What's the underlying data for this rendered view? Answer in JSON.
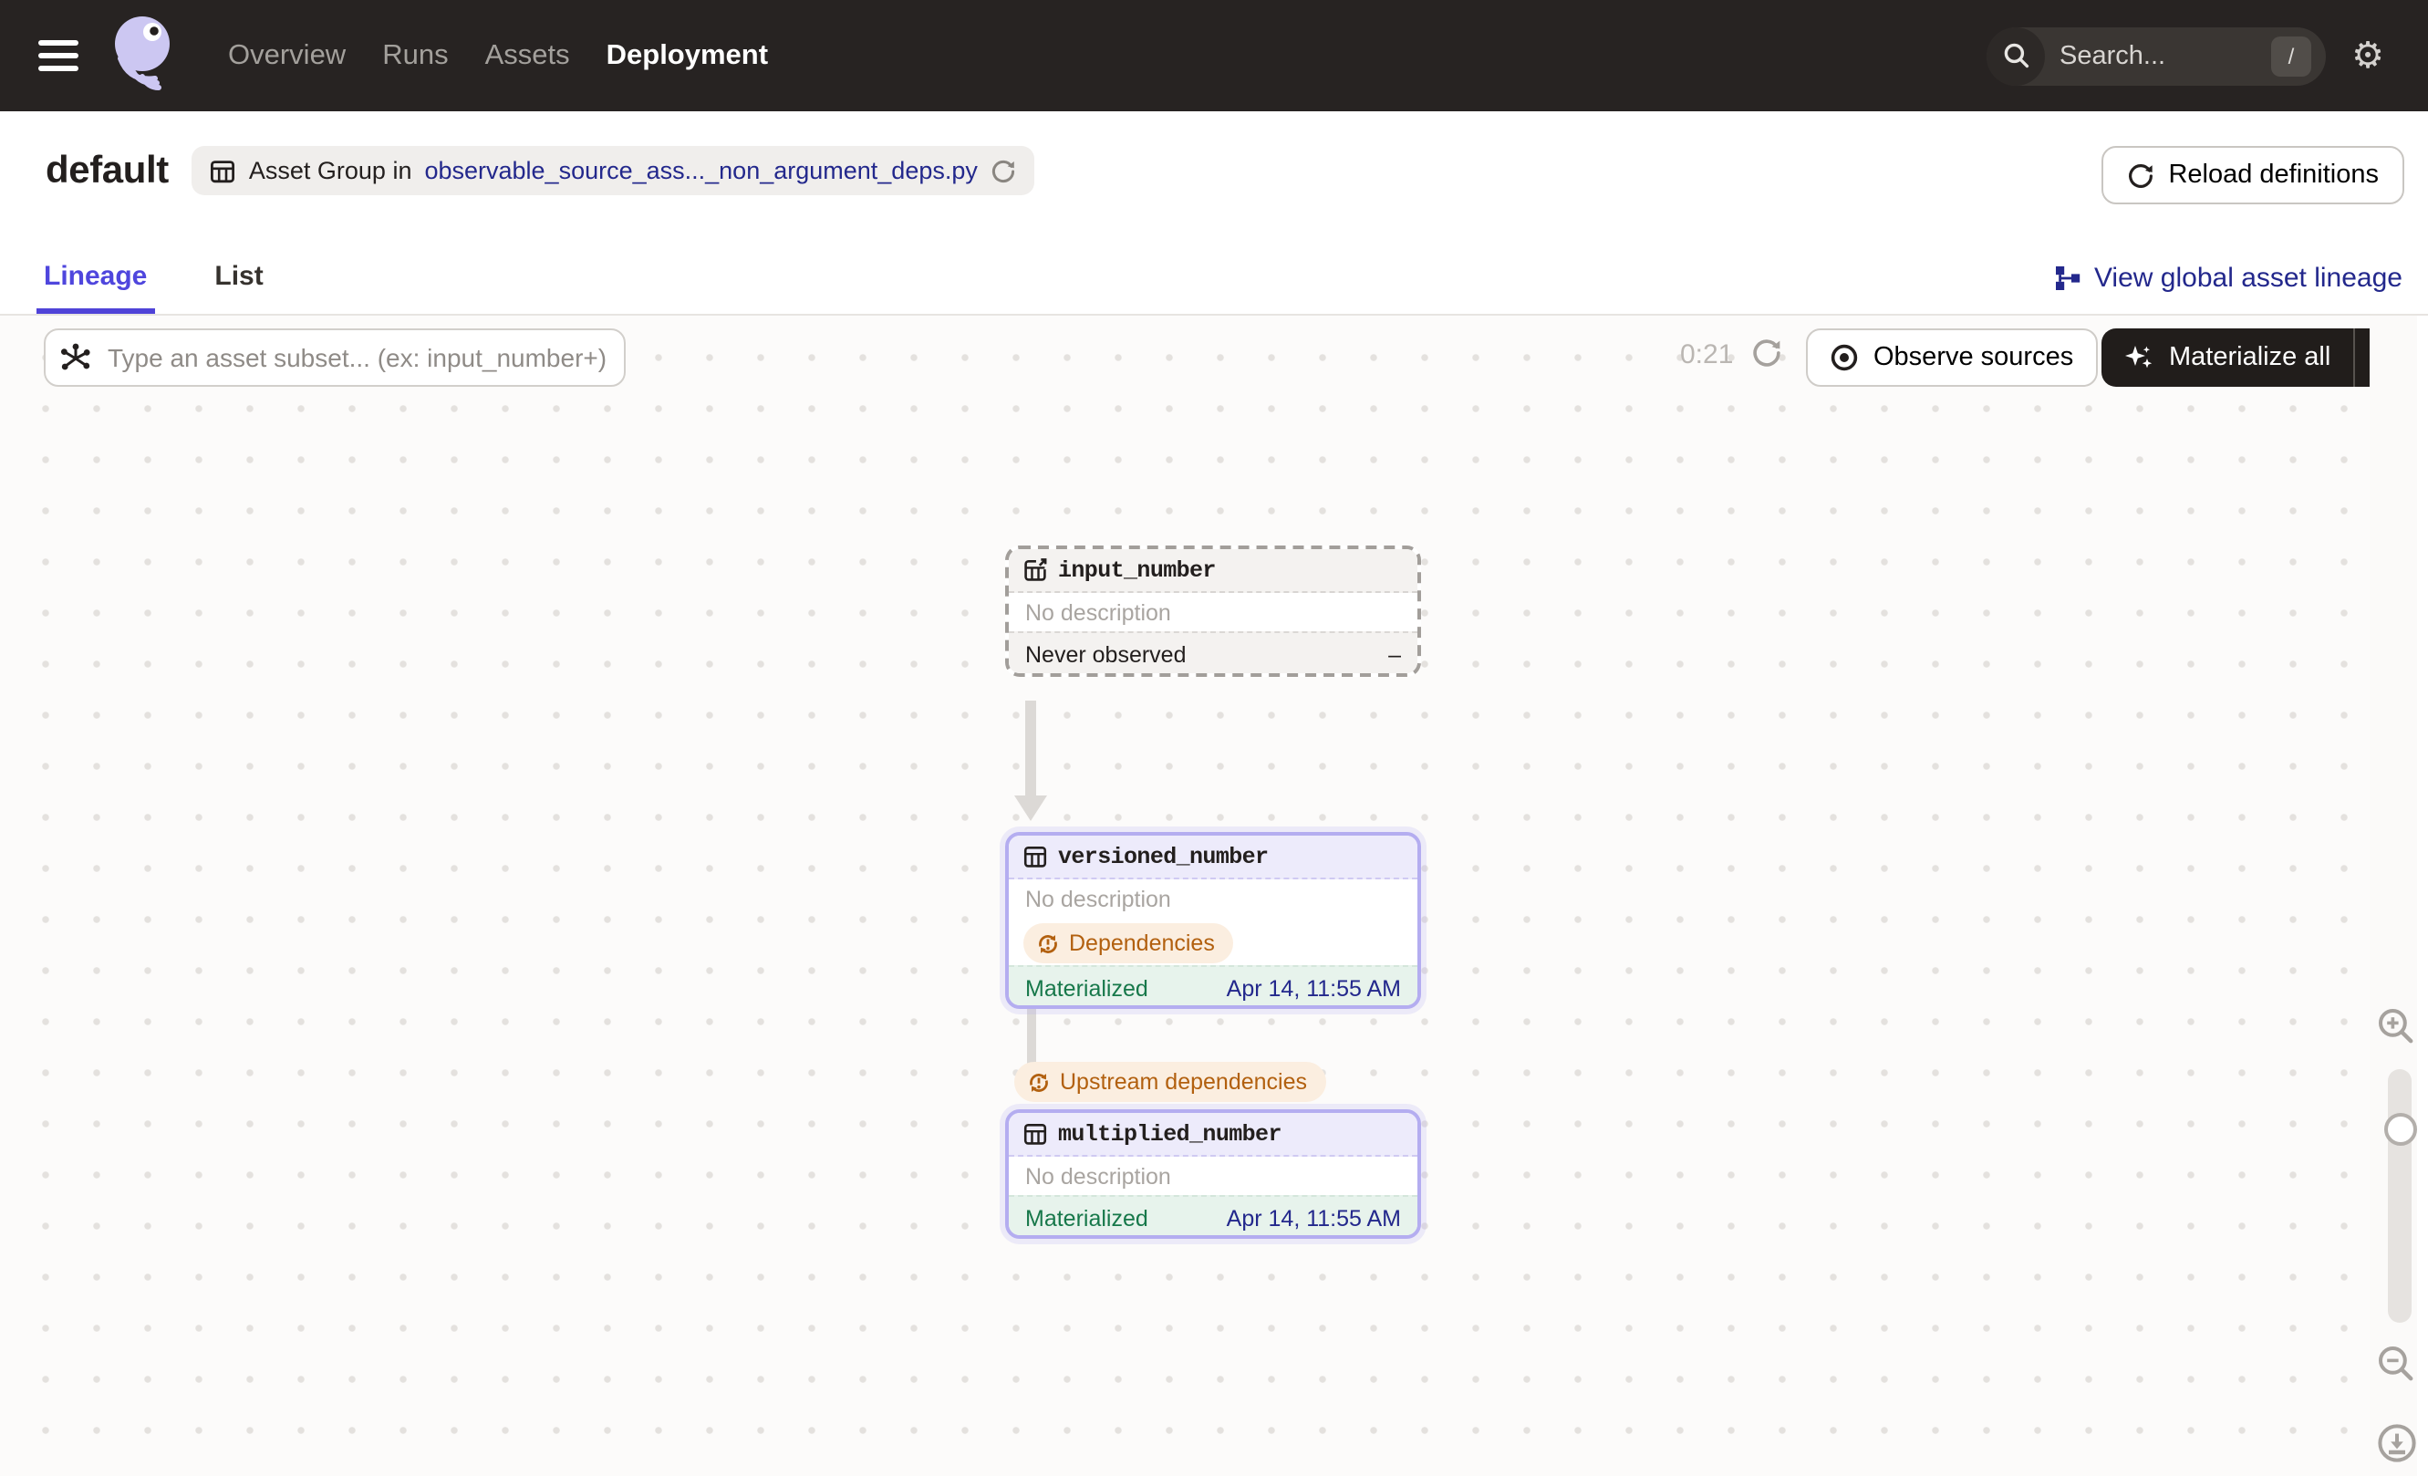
{
  "nav": {
    "items": [
      {
        "label": "Overview",
        "active": false
      },
      {
        "label": "Runs",
        "active": false
      },
      {
        "label": "Assets",
        "active": false
      },
      {
        "label": "Deployment",
        "active": true
      }
    ],
    "search_placeholder": "Search...",
    "search_shortcut": "/"
  },
  "header": {
    "title": "default",
    "asset_group_prefix": "Asset Group in",
    "asset_group_link": "observable_source_ass..._non_argument_deps.py",
    "reload_button": "Reload definitions"
  },
  "tabs": {
    "lineage": "Lineage",
    "list": "List",
    "view_global_link": "View global asset lineage"
  },
  "toolbar": {
    "filter_placeholder": "Type an asset subset... (ex: input_number+)",
    "timer": "0:21",
    "observe_button": "Observe sources",
    "materialize_button": "Materialize all"
  },
  "graph": {
    "edge_label": "Upstream dependencies",
    "nodes": [
      {
        "name": "input_number",
        "description": "No description",
        "status": "Never observed",
        "status_value": "–"
      },
      {
        "name": "versioned_number",
        "description": "No description",
        "badge": "Dependencies",
        "status": "Materialized",
        "status_value": "Apr 14, 11:55 AM"
      },
      {
        "name": "multiplied_number",
        "description": "No description",
        "status": "Materialized",
        "status_value": "Apr 14, 11:55 AM"
      }
    ]
  },
  "colors": {
    "nav_bg": "#272322",
    "accent_purple": "#4f43d8",
    "node_purple_border": "#b4adf0",
    "link_navy": "#23288c",
    "badge_orange_text": "#b2600f",
    "badge_orange_bg": "#fbeee0",
    "materialized_green": "#17784a",
    "dark_button_bg": "#211d1b"
  }
}
